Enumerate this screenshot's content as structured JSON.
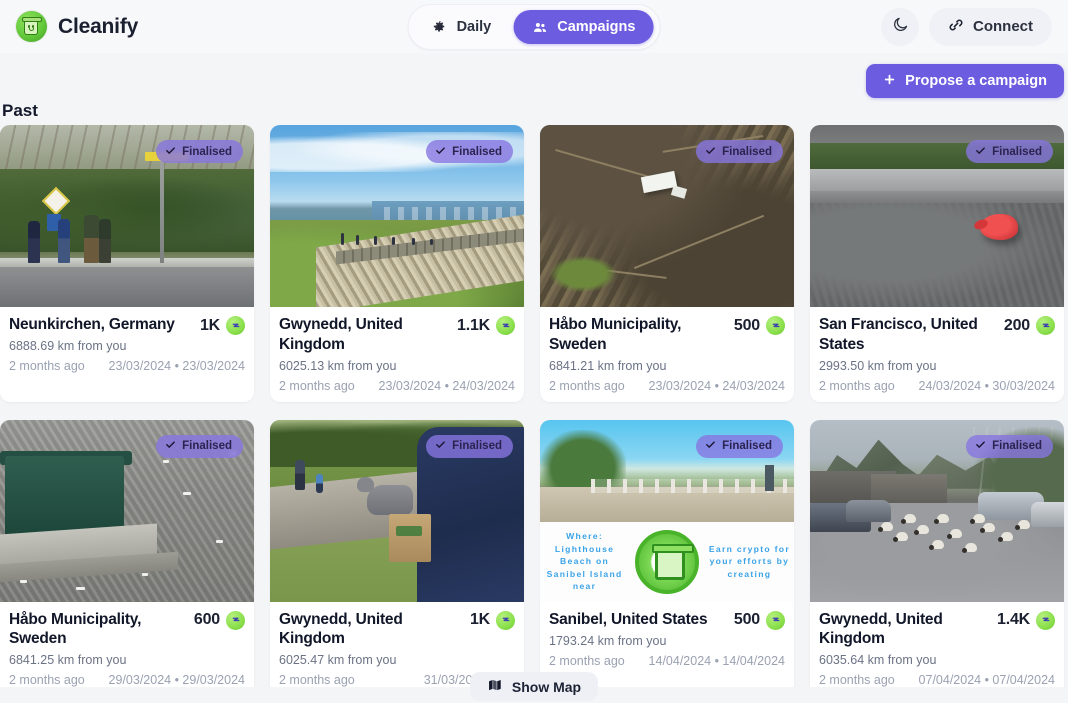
{
  "app": {
    "brand_name": "Cleanify",
    "logo_icon": "cleanify-bin-logo-icon"
  },
  "header": {
    "tabs": [
      {
        "label": "Daily",
        "icon": "gear-icon",
        "active": false
      },
      {
        "label": "Campaigns",
        "icon": "people-icon",
        "active": true
      }
    ],
    "dark_mode_icon": "moon-icon",
    "connect_label": "Connect",
    "connect_icon": "link-icon"
  },
  "section": {
    "title": "Past",
    "propose_label": "Propose a campaign",
    "propose_icon": "plus-icon"
  },
  "footer": {
    "show_map_label": "Show Map",
    "show_map_icon": "map-icon"
  },
  "colors": {
    "accent_purple": "#6c5ce0",
    "badge_purple": "#8776e1",
    "token_green": "#8adf4b",
    "page_bg": "#f4f5f7",
    "card_bg": "#ffffff",
    "muted_text": "#9aa1b1"
  },
  "labels": {
    "badge_finalised": "Finalised",
    "badge_icon": "check-icon",
    "token_icon": "green-token-icon"
  },
  "cards": [
    {
      "title": "Neunkirchen, Germany",
      "reward": "1K",
      "distance": "6888.69 km from you",
      "relative": "2 months ago",
      "dates": "23/03/2024 • 23/03/2024",
      "status": "Finalised",
      "image_alt": "volunteers-collecting-litter-roadside"
    },
    {
      "title": "Gwynedd, United Kingdom",
      "reward": "1.1K",
      "distance": "6025.13 km from you",
      "relative": "2 months ago",
      "dates": "23/03/2024 • 24/03/2024",
      "status": "Finalised",
      "image_alt": "coastal-path-with-walkers"
    },
    {
      "title": "Håbo Municipality, Sweden",
      "reward": "500",
      "distance": "6841.21 km from you",
      "relative": "2 months ago",
      "dates": "23/03/2024 • 24/03/2024",
      "status": "Finalised",
      "image_alt": "litter-on-forest-ground"
    },
    {
      "title": "San Francisco, United States",
      "reward": "200",
      "distance": "2993.50 km from you",
      "relative": "2 months ago",
      "dates": "24/03/2024 • 30/03/2024",
      "status": "Finalised",
      "image_alt": "red-plastic-bag-on-pavement"
    },
    {
      "title": "Håbo Municipality, Sweden",
      "reward": "600",
      "distance": "6841.25 km from you",
      "relative": "2 months ago",
      "dates": "29/03/2024 • 29/03/2024",
      "status": "Finalised",
      "image_alt": "green-dumpster-with-scattered-litter"
    },
    {
      "title": "Gwynedd, United Kingdom",
      "reward": "1K",
      "distance": "6025.47 km from you",
      "relative": "2 months ago",
      "dates": "31/03/2024 • 31/",
      "status": "Finalised",
      "image_alt": "person-carrying-bag-with-dog-on-path"
    },
    {
      "title": "Sanibel, United States",
      "reward": "500",
      "distance": "1793.24 km from you",
      "relative": "2 months ago",
      "dates": "14/04/2024 • 14/04/2024",
      "status": "Finalised",
      "image_alt": "sanibel-beach-cleanup-flyer",
      "flyer": {
        "left_text": "Where: Lighthouse Beach on Sanibel Island near",
        "right_text": "Earn crypto for your efforts by creating"
      }
    },
    {
      "title": "Gwynedd, United Kingdom",
      "reward": "1.4K",
      "distance": "6035.64 km from you",
      "relative": "2 months ago",
      "dates": "07/04/2024 • 07/04/2024",
      "status": "Finalised",
      "image_alt": "sheep-walking-through-car-park"
    }
  ]
}
